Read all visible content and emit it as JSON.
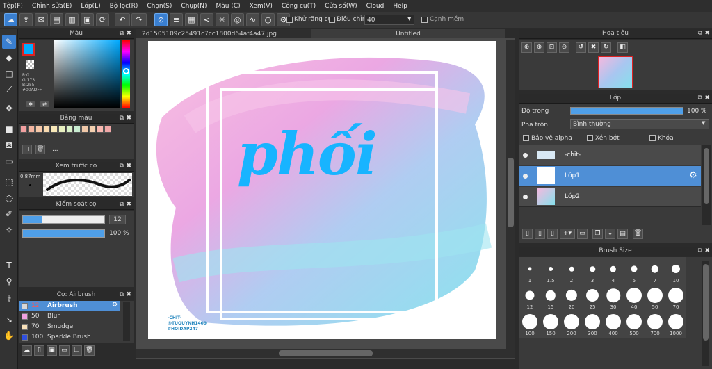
{
  "menu": [
    "Tệp(F)",
    "Chỉnh sửa(E)",
    "Lớp(L)",
    "Bộ lọc(R)",
    "Chọn(S)",
    "Chụp(N)",
    "Màu (C)",
    "Xem(V)",
    "Công cụ(T)",
    "Cửa sổ(W)",
    "Cloud",
    "Help"
  ],
  "toolbar": {
    "antialias_label": "Khử răng cưa",
    "correction_label": "Điều chỉnh",
    "correction_value": "40",
    "smooth_edge_label": "Cạnh mềm"
  },
  "color_panel": {
    "title": "Màu",
    "r": "R:0",
    "g": "G:173",
    "b": "B:255",
    "hex": "#00ADFF",
    "fg_color": "#00ADFF"
  },
  "palette": {
    "title": "Bảng màu",
    "colors": [
      "#f2a0a0",
      "#f4b5a0",
      "#f6c8a8",
      "#f8dab0",
      "#f8e8b8",
      "#e8f0c0",
      "#d8f0c8",
      "#c8ecd0",
      "#f0c8a8",
      "#f4d0b0",
      "#f8b8b0",
      "#f0a8a8"
    ],
    "more": "..."
  },
  "brush_preview": {
    "title": "Xem trước cọ",
    "size": "0.87mm"
  },
  "brush_control": {
    "title": "Kiểm soát cọ",
    "size_value": "12",
    "opacity_value": "100 %"
  },
  "brushes": {
    "title": "Cọ: Airbrush",
    "items": [
      {
        "size": "12",
        "name": "Airbrush",
        "color": "#d8d8d8"
      },
      {
        "size": "50",
        "name": "Blur",
        "color": "#f0a0e0"
      },
      {
        "size": "70",
        "name": "Smudge",
        "color": "#f8e0b8"
      },
      {
        "size": "100",
        "name": "Sparkle Brush",
        "color": "#3050e0"
      }
    ]
  },
  "tabs": [
    "2d1505109c25491c7cc1800d64af4a47.jpg",
    "Untitled"
  ],
  "artwork": {
    "word": "phối",
    "credit_1": "-CHIT-",
    "credit_2": "@TUQUYNH1409",
    "credit_3": "#HOIDAP247"
  },
  "navigator": {
    "title": "Hoa tiêu"
  },
  "layer_panel": {
    "title": "Lớp",
    "opacity_label": "Độ trong",
    "opacity_value": "100 %",
    "blend_label": "Pha trộn",
    "blend_value": "Bình thường",
    "protect_alpha": "Bảo vệ alpha",
    "clipping": "Xén bớt",
    "lock": "Khóa",
    "layers": [
      "-chit-",
      "Lớp1",
      "Lớp2"
    ]
  },
  "brush_size": {
    "title": "Brush Size",
    "sizes": [
      "1",
      "1.5",
      "2",
      "3",
      "4",
      "5",
      "7",
      "10",
      "12",
      "15",
      "20",
      "25",
      "30",
      "40",
      "50",
      "70",
      "100",
      "150",
      "200",
      "300",
      "400",
      "500",
      "700",
      "1000"
    ]
  }
}
